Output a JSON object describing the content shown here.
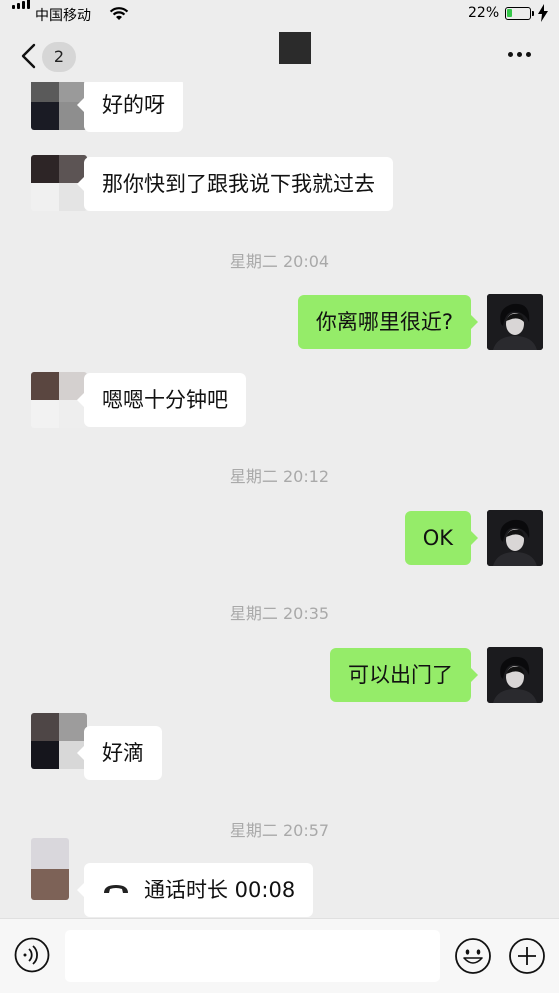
{
  "status_bar": {
    "carrier": "中国移动",
    "battery_pct": "22%",
    "battery_level": 0.22
  },
  "nav": {
    "unread_count": "2"
  },
  "messages": [
    {
      "side": "in",
      "text": "好的呀"
    },
    {
      "side": "in",
      "text": "那你快到了跟我说下我就过去"
    },
    {
      "side": "time",
      "text": "星期二 20:04"
    },
    {
      "side": "out",
      "text": "你离哪里很近?"
    },
    {
      "side": "in",
      "text": "嗯嗯十分钟吧"
    },
    {
      "side": "time",
      "text": "星期二 20:12"
    },
    {
      "side": "out",
      "text": "OK"
    },
    {
      "side": "time",
      "text": "星期二 20:35"
    },
    {
      "side": "out",
      "text": "可以出门了"
    },
    {
      "side": "in",
      "text": "好滴"
    },
    {
      "side": "time",
      "text": "星期二 20:57"
    },
    {
      "side": "in",
      "text": "通话时长 00:08",
      "icon": "phone-hangup-icon"
    }
  ],
  "input": {
    "value": ""
  },
  "colors": {
    "background": "#ededed",
    "outgoing_bubble": "#95ec69",
    "incoming_bubble": "#ffffff",
    "battery": "#36c74a"
  }
}
